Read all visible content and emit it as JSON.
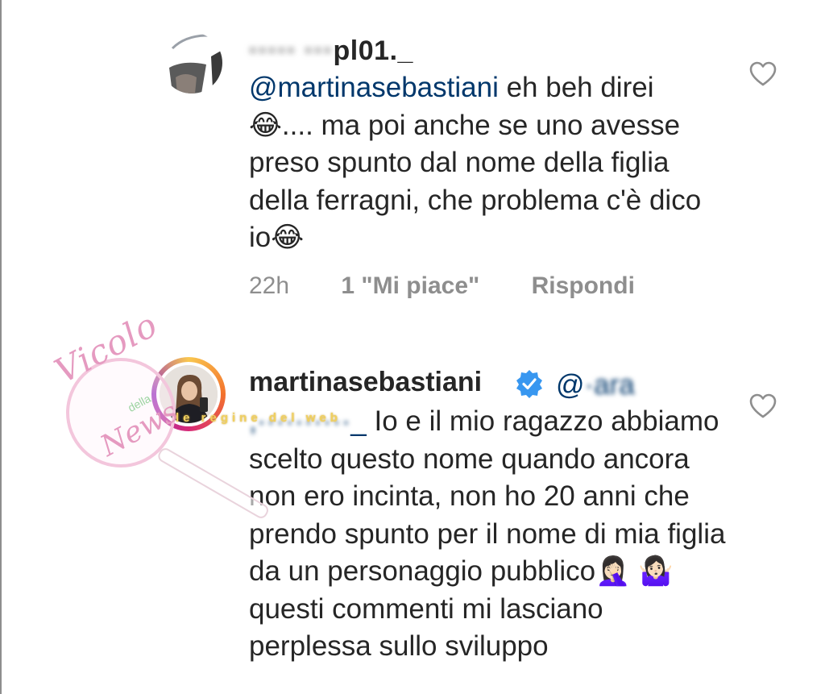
{
  "comment1": {
    "username_visible": "pl01._",
    "mention": "@martinasebastiani",
    "text": " eh beh direi😂.... ma poi anche se uno avesse preso spunto dal nome della figlia della ferragni, che problema c'è dico io😂",
    "time": "22h",
    "likes": "1 \"Mi piace\"",
    "reply": "Rispondi",
    "heart_icon": "heart-outline-icon"
  },
  "comment2": {
    "username": "martinasebastiani",
    "verified_icon": "verified-badge-icon",
    "mention_visible": "@",
    "mention_end": "_",
    "text": " Io e il mio ragazzo abbiamo scelto questo nome quando ancora non ero incinta, non ho 20 anni che prendo spunto per il nome di mia figlia da un personaggio pubblico🤦🏻‍♀️ 🤷🏻‍♀️ questi commenti mi lasciano perplessa sullo sviluppo",
    "heart_icon": "heart-outline-icon"
  },
  "watermark": {
    "line1": "Vicolo",
    "line2": "della",
    "line3": "News",
    "banner": "le regine del web"
  },
  "colors": {
    "mention": "#00376b",
    "text": "#262626",
    "meta": "#8e8e8e",
    "verified": "#3897f0",
    "watermark_pink": "#e59ac0"
  }
}
